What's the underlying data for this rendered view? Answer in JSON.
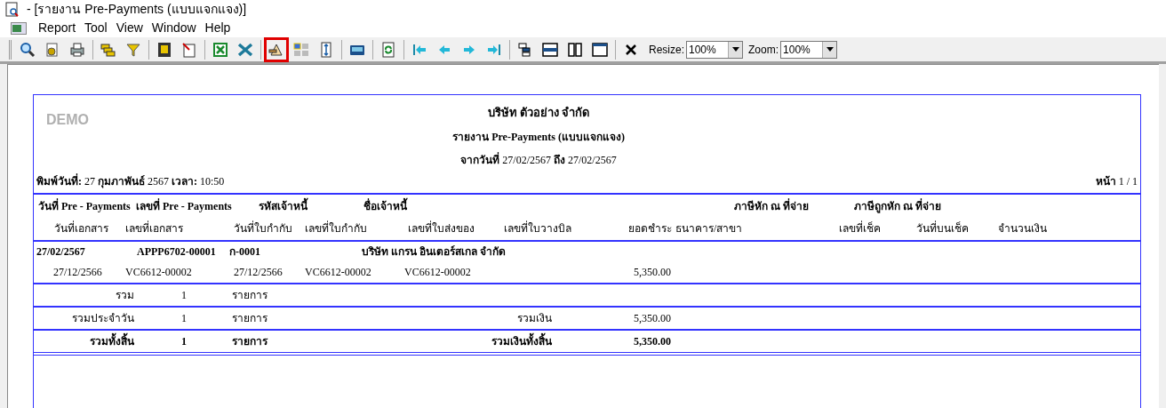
{
  "window": {
    "title": "- [รายงาน Pre-Payments (แบบแจกแจง)]"
  },
  "menu": [
    "Report",
    "Tool",
    "View",
    "Window",
    "Help"
  ],
  "toolbar": {
    "buttons": [
      {
        "highlighted": false
      },
      {
        "highlighted": false
      },
      {
        "highlighted": false
      },
      {
        "highlighted": false
      },
      {
        "highlighted": false
      },
      {
        "highlighted": false
      },
      {
        "highlighted": false
      },
      {
        "highlighted": false
      },
      {
        "highlighted": false
      },
      {
        "highlighted": true
      },
      {
        "highlighted": false
      },
      {
        "highlighted": false
      },
      {
        "highlighted": false
      },
      {
        "highlighted": false
      },
      {
        "highlighted": false
      },
      {
        "highlighted": false
      },
      {
        "highlighted": false
      },
      {
        "highlighted": false
      },
      {
        "highlighted": false
      },
      {
        "highlighted": false
      },
      {
        "highlighted": false
      },
      {
        "highlighted": false
      },
      {
        "highlighted": false
      }
    ],
    "combos": [
      {
        "label": "Resize:",
        "value": "100%"
      },
      {
        "label": "Zoom:",
        "value": "100%"
      }
    ]
  },
  "report": {
    "watermark": "DEMO",
    "company": "บริษัท ตัวอย่าง จำกัด",
    "title": "รายงาน Pre-Payments (แบบแจกแจง)",
    "date_range": "**จากวันที่** 27/02/2567 **ถึง** 27/02/2567",
    "printed": "**พิมพ์วันที่:** 27 **กุมภาพันธ์** 2567 **เวลา:** 10:50",
    "page": "**หน้า** 1 / 1",
    "header_1": [
      "วันที่ Pre - Payments",
      "เลขที่ Pre - Payments",
      "รหัสเจ้าหนี้",
      "ชื่อเจ้าหนี้",
      "ภาษีหัก ณ ที่จ่าย",
      "ภาษีถูกหัก ณ ที่จ่าย"
    ],
    "header_2": [
      "วันที่เอกสาร",
      "เลขที่เอกสาร",
      "วันที่ใบกำกับ",
      "เลขที่ใบกำกับ",
      "เลขที่ใบส่งของ",
      "เลขที่ใบวางบิล",
      "ยอดชำระ",
      "ธนาคาร/สาขา",
      "เลขที่เช็ค",
      "วันที่บนเช็ค",
      "จำนวนเงิน"
    ],
    "group": [
      "27/02/2567",
      "APPP6702-00001",
      "ก-0001",
      "บริษัท แกรน อินเตอร์สเกล จำกัด"
    ],
    "detail": [
      "27/12/2566",
      "VC6612-00002",
      "27/12/2566",
      "VC6612-00002",
      "VC6612-00002",
      "5,350.00"
    ],
    "totals": [
      {
        "label": "รวม",
        "count": "1",
        "unit": "รายการ",
        "bold": false
      },
      {
        "label": "รวมประจำวัน",
        "count": "1",
        "unit": "รายการ",
        "sum_label": "รวมเงิน",
        "amount": "5,350.00",
        "bold": false
      },
      {
        "label": "รวมทั้งสิ้น",
        "count": "1",
        "unit": "รายการ",
        "sum_label": "รวมเงินทั้งสิ้น",
        "amount": "5,350.00",
        "bold": true
      }
    ]
  }
}
